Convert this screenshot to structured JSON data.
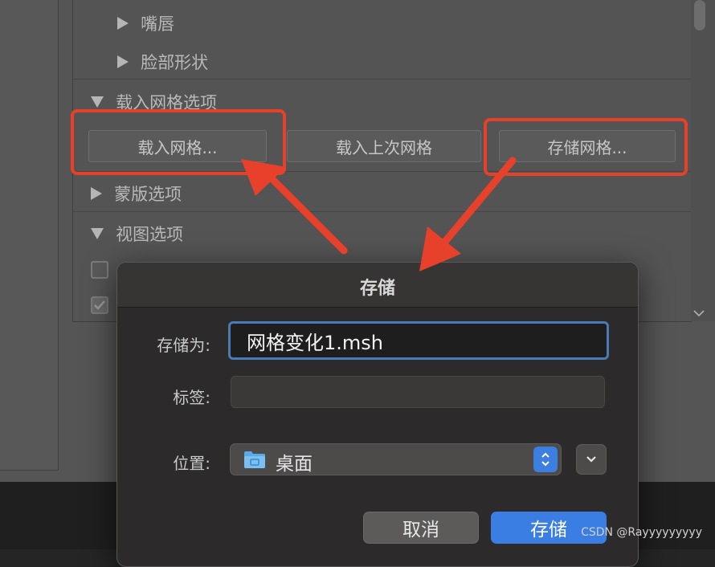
{
  "panel": {
    "rows": {
      "lips": "嘴唇",
      "face_shape": "脸部形状",
      "load_mesh_options": "载入网格选项",
      "mask_options": "蒙版选项",
      "view_options": "视图选项"
    },
    "buttons": {
      "load_mesh": "载入网格...",
      "load_last_mesh": "载入上次网格",
      "save_mesh": "存储网格..."
    }
  },
  "dialog": {
    "title": "存储",
    "save_as_label": "存储为:",
    "save_as_value": "网格变化1.msh",
    "tags_label": "标签:",
    "tags_value": "",
    "location_label": "位置:",
    "location_value": "桌面",
    "cancel_label": "取消",
    "save_label": "存储"
  },
  "watermark": "CSDN @Rayyyyyyyyy",
  "colors": {
    "highlight": "#e8412b",
    "accent": "#3a7de3",
    "focus_ring": "#4a7bb4"
  }
}
